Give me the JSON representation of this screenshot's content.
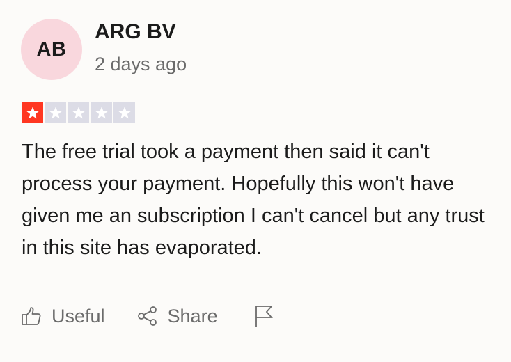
{
  "review": {
    "author": {
      "initials": "AB",
      "name": "ARG BV",
      "avatar_color": "#f9d7dd"
    },
    "date": "2 days ago",
    "rating": {
      "value": 1,
      "max": 5,
      "filled_color": "#ff3722",
      "empty_color": "#dcdce6"
    },
    "text": "The free trial took a payment then said it can't process your payment. Hopefully this won't have given me an subscription I can't cancel but any trust in this site has evaporated."
  },
  "actions": {
    "useful": {
      "label": "Useful",
      "icon": "thumbs-up-icon"
    },
    "share": {
      "label": "Share",
      "icon": "share-icon"
    },
    "report": {
      "icon": "flag-icon"
    }
  }
}
